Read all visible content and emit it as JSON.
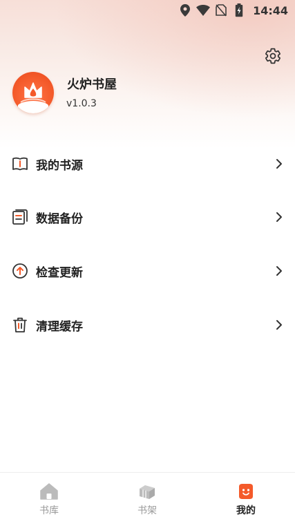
{
  "status_bar": {
    "time": "14:44",
    "icons": [
      "location-icon",
      "wifi-icon",
      "no-sim-icon",
      "battery-charging-icon"
    ]
  },
  "profile": {
    "app_name": "火炉书屋",
    "version": "v1.0.3",
    "avatar_icon": "fire-logo-icon",
    "settings_icon": "gear-icon"
  },
  "menu": {
    "items": [
      {
        "label": "我的书源",
        "icon": "book-source-icon"
      },
      {
        "label": "数据备份",
        "icon": "backup-document-icon"
      },
      {
        "label": "检查更新",
        "icon": "update-arrow-icon"
      },
      {
        "label": "清理缓存",
        "icon": "trash-icon"
      }
    ]
  },
  "bottom_nav": {
    "items": [
      {
        "label": "书库",
        "icon": "home-icon",
        "active": false
      },
      {
        "label": "书架",
        "icon": "bookshelf-icon",
        "active": false
      },
      {
        "label": "我的",
        "icon": "smiley-icon",
        "active": true
      }
    ]
  },
  "colors": {
    "accent": "#f45a2a",
    "inactive": "#999999",
    "text": "#222222"
  }
}
